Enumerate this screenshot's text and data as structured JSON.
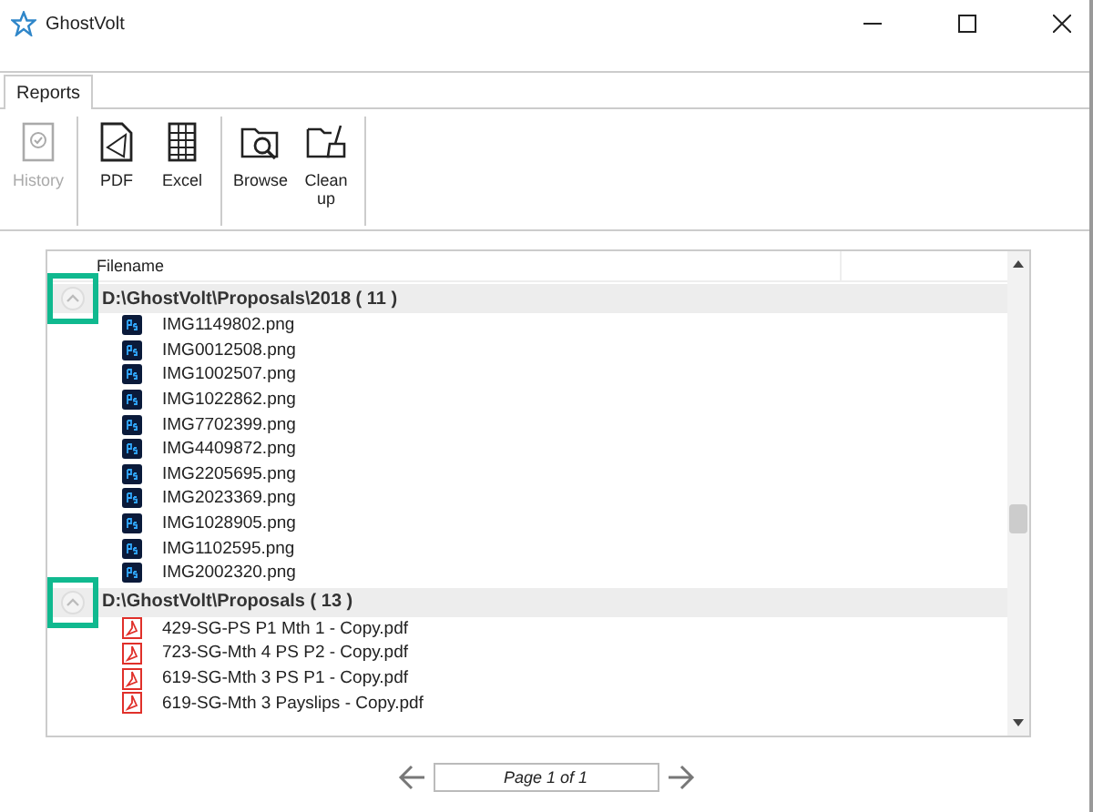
{
  "window": {
    "title": "GhostVolt"
  },
  "tabs": [
    {
      "label": "Reports",
      "selected": true
    }
  ],
  "ribbon_groups": [
    [
      {
        "label": "History",
        "kind": "history",
        "disabled": true
      }
    ],
    [
      {
        "label": "PDF",
        "kind": "pdf",
        "disabled": false
      },
      {
        "label": "Excel",
        "kind": "excel",
        "disabled": false
      }
    ],
    [
      {
        "label": "Browse",
        "kind": "browse",
        "disabled": false
      },
      {
        "label": "Clean up",
        "kind": "cleanup",
        "disabled": false
      }
    ]
  ],
  "table": {
    "columns": [
      "Filename"
    ],
    "groups": [
      {
        "path": "D:\\GhostVolt\\Proposals\\2018",
        "count": "( 11 )",
        "expanded": true,
        "highlighted": true,
        "files": [
          {
            "name": "IMG1149802.png",
            "kind": "ps"
          },
          {
            "name": "IMG0012508.png",
            "kind": "ps"
          },
          {
            "name": "IMG1002507.png",
            "kind": "ps"
          },
          {
            "name": "IMG1022862.png",
            "kind": "ps"
          },
          {
            "name": "IMG7702399.png",
            "kind": "ps"
          },
          {
            "name": "IMG4409872.png",
            "kind": "ps"
          },
          {
            "name": "IMG2205695.png",
            "kind": "ps"
          },
          {
            "name": "IMG2023369.png",
            "kind": "ps"
          },
          {
            "name": "IMG1028905.png",
            "kind": "ps"
          },
          {
            "name": "IMG1102595.png",
            "kind": "ps"
          },
          {
            "name": "IMG2002320.png",
            "kind": "ps"
          }
        ]
      },
      {
        "path": "D:\\GhostVolt\\Proposals",
        "count": "( 13 )",
        "expanded": true,
        "highlighted": true,
        "files": [
          {
            "name": "429-SG-PS P1 Mth 1 - Copy.pdf",
            "kind": "pdf"
          },
          {
            "name": "723-SG-Mth 4 PS P2 - Copy.pdf",
            "kind": "pdf"
          },
          {
            "name": "619-SG-Mth 3 PS P1 - Copy.pdf",
            "kind": "pdf"
          },
          {
            "name": "619-SG-Mth 3 Payslips - Copy.pdf",
            "kind": "pdf"
          }
        ]
      }
    ]
  },
  "pagination": {
    "value": "Page 1 of 1"
  }
}
